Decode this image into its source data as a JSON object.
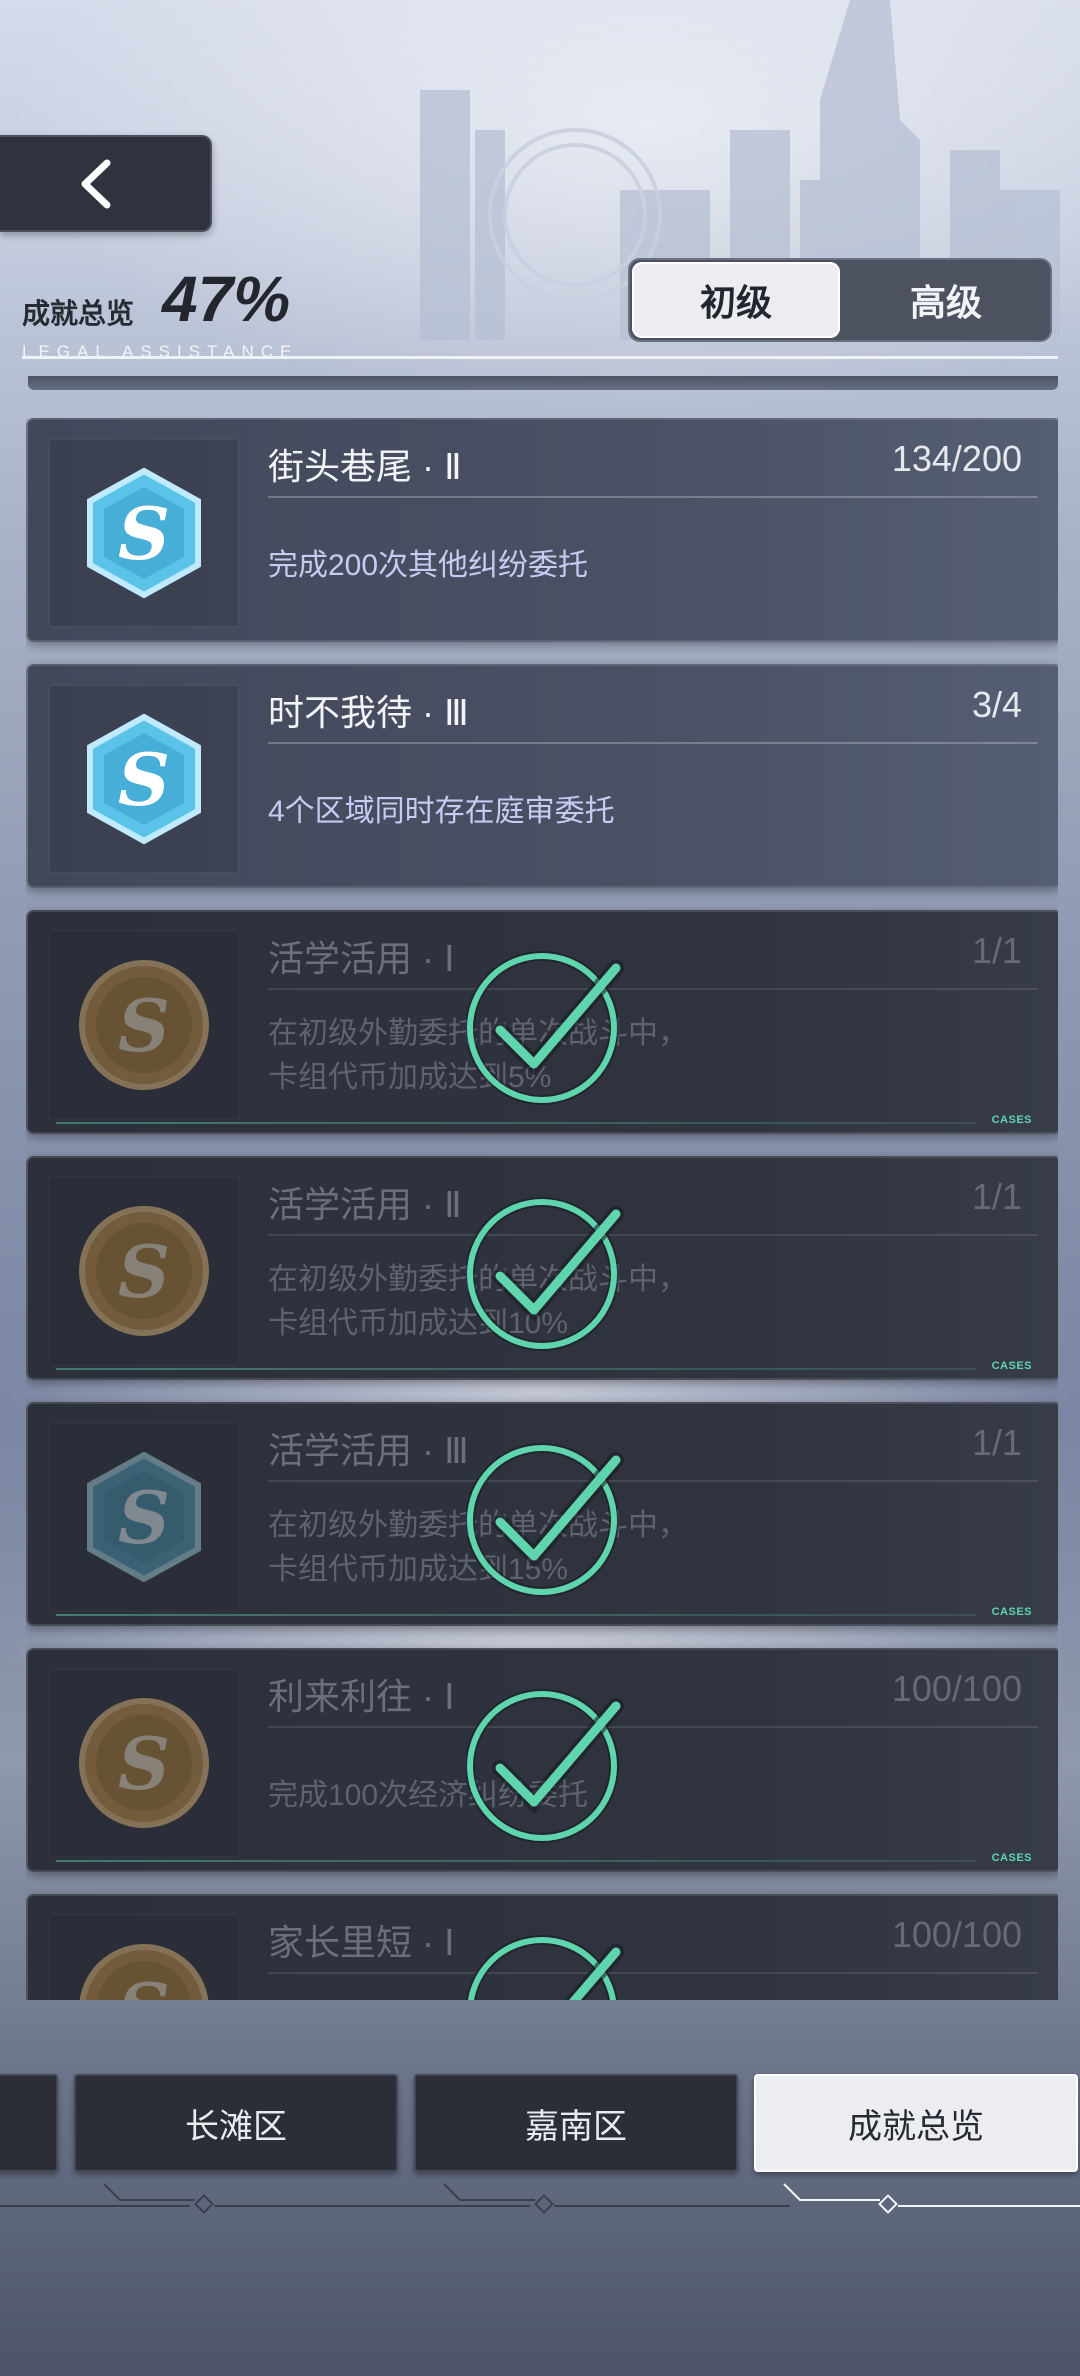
{
  "header": {
    "back_icon": "chevron-left-icon",
    "progress_label": "成就总览",
    "progress_value": "47%",
    "progress_subtitle": "LEGAL ASSISTANCE",
    "tabs": [
      {
        "label": "初级",
        "active": true
      },
      {
        "label": "高级",
        "active": false
      }
    ]
  },
  "achievements": [
    {
      "title": "街头巷尾 ·  Ⅱ",
      "count": "134/200",
      "desc": "完成200次其他纠纷委托",
      "medal": "silver-s-medal-icon",
      "completed": false
    },
    {
      "title": "时不我待 · Ⅲ",
      "count": "3/4",
      "desc": "4个区域同时存在庭审委托",
      "medal": "silver-s-medal-icon",
      "completed": false
    },
    {
      "title": "活学活用 ·  Ⅰ",
      "count": "1/1",
      "desc": "在初级外勤委托的单次战斗中，\n卡组代币加成达到5%",
      "medal": "bronze-s-medal-icon",
      "completed": true
    },
    {
      "title": "活学活用 ·  Ⅱ",
      "count": "1/1",
      "desc": "在初级外勤委托的单次战斗中，\n卡组代币加成达到10%",
      "medal": "bronze-s-medal-icon",
      "completed": true
    },
    {
      "title": "活学活用 ·  Ⅲ",
      "count": "1/1",
      "desc": "在初级外勤委托的单次战斗中，\n卡组代币加成达到15%",
      "medal": "silver-s-medal-icon",
      "completed": true
    },
    {
      "title": "利来利往 ·  Ⅰ",
      "count": "100/100",
      "desc": "完成100次经济纠纷委托",
      "medal": "bronze-s-medal-icon",
      "completed": true
    },
    {
      "title": "家长里短 ·  Ⅰ",
      "count": "100/100",
      "desc": "",
      "medal": "bronze-s-medal-icon",
      "completed": true
    }
  ],
  "cases_tag": "CASES",
  "bottom_nav": {
    "items": [
      {
        "label": "",
        "active": false
      },
      {
        "label": "长滩区",
        "active": false
      },
      {
        "label": "嘉南区",
        "active": false
      },
      {
        "label": "成就总览",
        "active": true
      }
    ]
  },
  "colors": {
    "completed_check": "#5fd5ae",
    "active_tab_bg": "#ecedf0",
    "card_bg": "#454c5e",
    "desc_text": "#c8caf2"
  }
}
